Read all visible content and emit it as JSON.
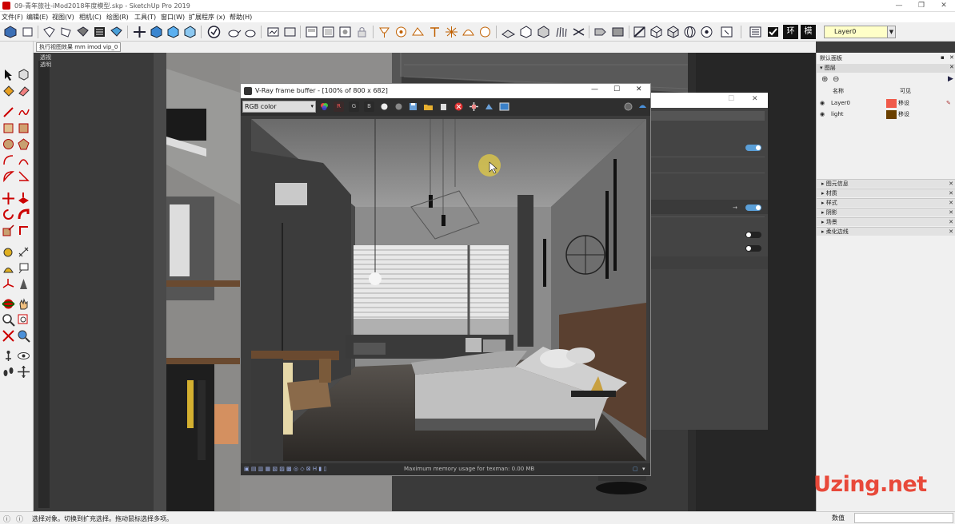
{
  "window": {
    "title": "09-青年旅社-iMod2018年度模型.skp - SketchUp Pro 2019",
    "controls": [
      "—",
      "❐",
      "✕"
    ]
  },
  "menubar": [
    "文件(F)",
    "编辑(E)",
    "视图(V)",
    "相机(C)",
    "绘图(R)",
    "工具(T)",
    "窗口(W)",
    "扩展程序 (x)",
    "帮助(H)"
  ],
  "toolbar": {
    "labels": [
      "环",
      "模"
    ],
    "layer_select": "Layer0"
  },
  "scene_tab": "执行视图效果 mm imod vip_0",
  "viewport_label": [
    "透视",
    "透明"
  ],
  "vfb": {
    "title": "V-Ray frame buffer - [100% of 800 x 682]",
    "controls": [
      "—",
      "☐",
      "✕"
    ],
    "channel": "RGB color",
    "buttons": [
      "R",
      "G",
      "B"
    ],
    "status": "Maximum memory usage for texman: 0.00 MB"
  },
  "right_panel": {
    "title": "默认面板",
    "section": "图层",
    "columns": [
      "名称",
      "可见"
    ],
    "layers": [
      {
        "name": "Layer0",
        "color": "#f05a4a",
        "label": "移设"
      },
      {
        "name": "light",
        "color": "#6b4000",
        "label": "移设"
      }
    ],
    "trays": [
      "图元信息",
      "材质",
      "样式",
      "阴影",
      "场景",
      "柔化边线"
    ]
  },
  "watermark": "Uzing.net",
  "statusbar": {
    "message": "选择对象。切换到扩充选择。拖动鼠标选择多项。",
    "measure_label": "数值"
  },
  "colors": {
    "accent": "#4a90d9",
    "watermark": "#e8493a",
    "layer_input": "#ffffc8"
  }
}
